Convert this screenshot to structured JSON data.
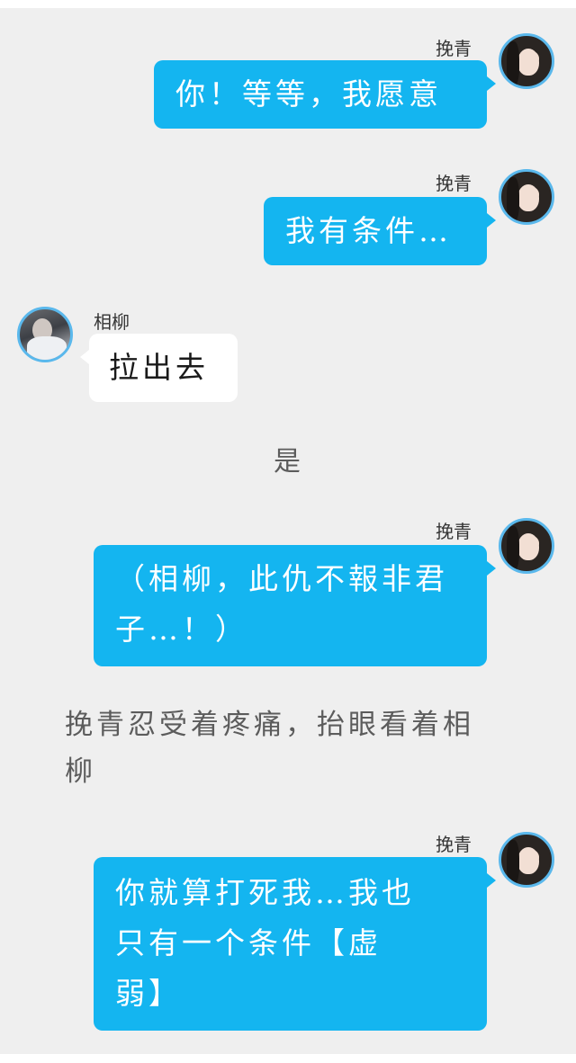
{
  "messages": [
    {
      "sender": "挽青",
      "side": "right",
      "avatar": "female-avatar",
      "text": "你！等等，我愿意"
    },
    {
      "sender": "挽青",
      "side": "right",
      "avatar": "female-avatar",
      "text": "我有条件…"
    },
    {
      "sender": "相柳",
      "side": "left",
      "avatar": "male-avatar",
      "text": "拉出去"
    },
    {
      "narration": "是"
    },
    {
      "sender": "挽青",
      "side": "right",
      "avatar": "female-avatar",
      "lines": [
        "（相柳，此仇不報非君",
        "子…！）"
      ]
    },
    {
      "narration_lines": [
        "挽青忍受着疼痛，抬眼看着相",
        "柳"
      ]
    },
    {
      "sender": "挽青",
      "side": "right",
      "avatar": "female-avatar",
      "lines": [
        "你就算打死我…我也",
        "只有一个条件【虚",
        "弱】"
      ]
    }
  ],
  "colors": {
    "background": "#efefef",
    "outgoing_bubble": "#14b5f0",
    "incoming_bubble": "#ffffff",
    "avatar_ring": "#5ab8ec",
    "narration_text": "#5c5c5c"
  }
}
